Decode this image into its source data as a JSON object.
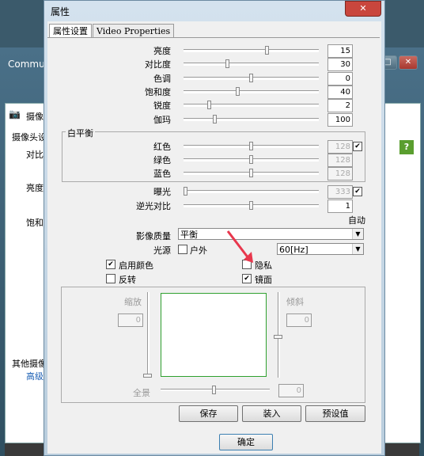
{
  "background_window": {
    "title": "Commu",
    "side_tab": "摄像",
    "labels": [
      "摄像头设",
      "对比",
      "亮度",
      "饱和",
      "其他摄像",
      "高级"
    ]
  },
  "dialog": {
    "title": "属性",
    "close_symbol": "✕",
    "tabs": [
      {
        "label": "属性设置",
        "active": true
      },
      {
        "label": "Video Properties",
        "active": false
      }
    ],
    "sliders": [
      {
        "label": "亮度",
        "value": "15",
        "level": 0.62
      },
      {
        "label": "对比度",
        "value": "30",
        "level": 0.32
      },
      {
        "label": "色调",
        "value": "0",
        "level": 0.5
      },
      {
        "label": "饱和度",
        "value": "40",
        "level": 0.4
      },
      {
        "label": "锐度",
        "value": "2",
        "level": 0.18
      },
      {
        "label": "伽玛",
        "value": "100",
        "level": 0.22
      }
    ],
    "white_balance": {
      "title": "白平衡",
      "checked": true,
      "channels": [
        {
          "label": "红色",
          "value": "128",
          "level": 0.5
        },
        {
          "label": "绿色",
          "value": "128",
          "level": 0.5
        },
        {
          "label": "蓝色",
          "value": "128",
          "level": 0.5
        }
      ]
    },
    "exposure": {
      "label": "曝光",
      "value": "333",
      "level": 0.0,
      "checked": true
    },
    "backlight": {
      "label": "逆光对比",
      "value": "1",
      "level": 0.5
    },
    "auto_label": "自动",
    "quality": {
      "label": "影像质量",
      "value": "平衡"
    },
    "light": {
      "label": "光源",
      "outdoor_label": "户外",
      "outdoor_checked": false,
      "freq": "60[Hz]"
    },
    "checkboxes": {
      "enable_color": {
        "label": "启用颜色",
        "checked": true
      },
      "invert": {
        "label": "反转",
        "checked": false
      },
      "privacy": {
        "label": "隐私",
        "checked": false
      },
      "mirror": {
        "label": "镜面",
        "checked": true
      }
    },
    "pan": {
      "zoom_label": "缩放",
      "zoom_value": "0",
      "tilt_label": "倾斜",
      "tilt_value": "0",
      "pan_label": "全景",
      "pan_value": "0"
    },
    "buttons": {
      "save": "保存",
      "load": "装入",
      "preset": "预设值",
      "ok": "确定"
    },
    "colors": {
      "preview_border": "#2fa02f",
      "arrow": "#e8374d"
    }
  }
}
